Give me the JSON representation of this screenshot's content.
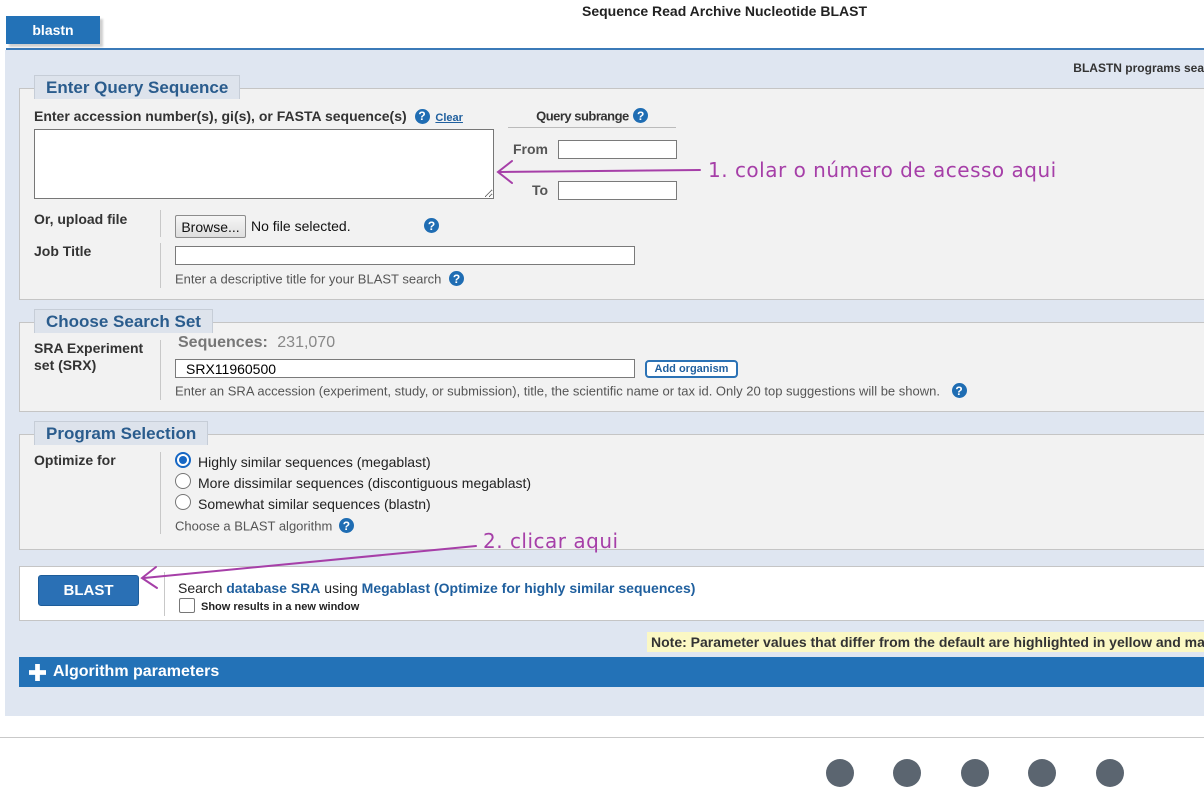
{
  "header": {
    "tab_label": "blastn",
    "page_title": "Sequence Read Archive Nucleotide BLAST"
  },
  "description_top": "BLASTN programs sea",
  "query": {
    "legend": "Enter Query Sequence",
    "label": "Enter accession number(s), gi(s), or FASTA sequence(s)",
    "clear_label": "Clear",
    "textarea_value": "",
    "subrange_title": "Query subrange",
    "from_label": "From",
    "to_label": "To",
    "from_value": "",
    "to_value": "",
    "upload_label": "Or, upload file",
    "browse_label": "Browse...",
    "file_status": "No file selected.",
    "job_title_label": "Job Title",
    "job_title_value": "",
    "job_title_hint": "Enter a descriptive title for your BLAST search"
  },
  "search_set": {
    "legend": "Choose Search Set",
    "label": "SRA Experiment set (SRX)",
    "sequences_label": "Sequences:",
    "sequences_value": "231,070",
    "srx_value": "SRX11960500",
    "add_organism_label": "Add organism",
    "hint": "Enter an SRA accession (experiment, study, or submission), title, the scientific name or tax id. Only 20 top suggestions will be shown."
  },
  "program": {
    "legend": "Program Selection",
    "label": "Optimize for",
    "options": [
      {
        "label": "Highly similar sequences (megablast)",
        "selected": true
      },
      {
        "label": "More dissimilar sequences (discontiguous megablast)",
        "selected": false
      },
      {
        "label": "Somewhat similar sequences (blastn)",
        "selected": false
      }
    ],
    "hint": "Choose a BLAST algorithm"
  },
  "submit": {
    "blast_label": "BLAST",
    "search_word": "Search",
    "database_link": "database SRA",
    "using_word": "using",
    "algorithm_link": "Megablast (Optimize for highly similar sequences)",
    "new_window_label": "Show results in a new window",
    "new_window_checked": false
  },
  "note": "Note: Parameter values that differ from the default are highlighted in yellow and ma",
  "algorithm_bar_label": "Algorithm parameters",
  "annotations": {
    "step1": "1. colar o número de acesso aqui",
    "step2": "2. clicar aqui",
    "color": "#a63fa8"
  },
  "icons": [
    "help-icon",
    "plus-icon",
    "arrow-annotation"
  ],
  "colors": {
    "accent_blue": "#2372b7",
    "panel_bg": "#dfe6f1",
    "legend_text": "#2a5c8d",
    "note_bg": "#fbf8c4"
  }
}
